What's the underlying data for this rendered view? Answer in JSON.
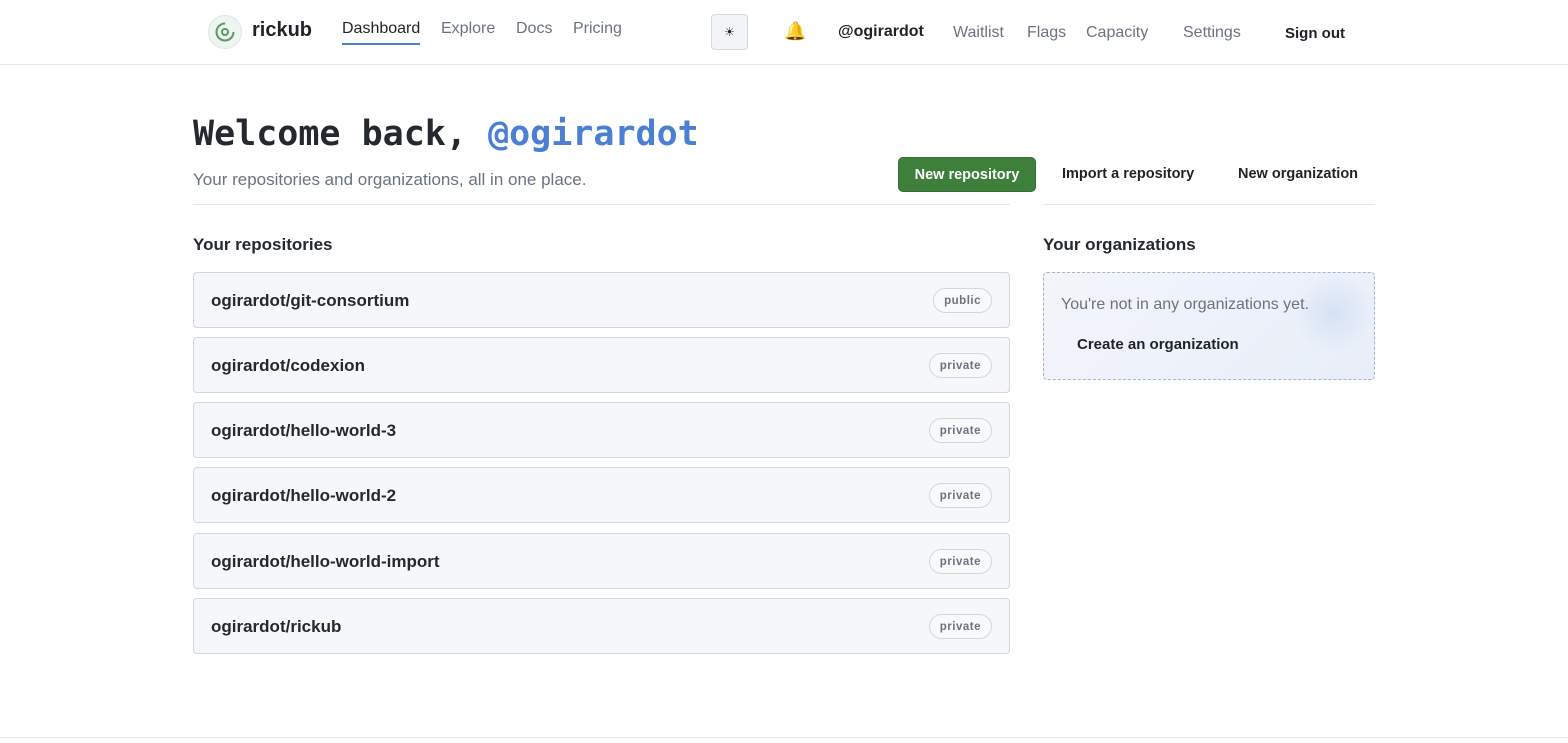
{
  "header": {
    "brand": "rickub",
    "nav": [
      "Dashboard",
      "Explore",
      "Docs",
      "Pricing"
    ],
    "theme_toggle_icon": "☀",
    "bell_icon": "🔔",
    "username": "@ogirardot",
    "right_links": [
      "Waitlist",
      "Flags",
      "Capacity",
      "Settings"
    ],
    "sign_out": "Sign out"
  },
  "hero": {
    "welcome_prefix": "Welcome back, ",
    "welcome_handle": "@ogirardot",
    "subtitle": "Your repositories and organizations, all in one place.",
    "new_repository": "New repository",
    "import_repository": "Import a repository",
    "new_organization": "New organization"
  },
  "repositories": {
    "title": "Your repositories",
    "items": [
      {
        "name": "ogirardot/git-consortium",
        "visibility": "public"
      },
      {
        "name": "ogirardot/codexion",
        "visibility": "private"
      },
      {
        "name": "ogirardot/hello-world-3",
        "visibility": "private"
      },
      {
        "name": "ogirardot/hello-world-2",
        "visibility": "private"
      },
      {
        "name": "ogirardot/hello-world-import",
        "visibility": "private"
      },
      {
        "name": "ogirardot/rickub",
        "visibility": "private"
      }
    ]
  },
  "organizations": {
    "title": "Your organizations",
    "empty": "You're not in any organizations yet.",
    "create": "Create an organization"
  },
  "colors": {
    "accent": "#4a7fd1",
    "primary_button": "#3f7f3c"
  }
}
